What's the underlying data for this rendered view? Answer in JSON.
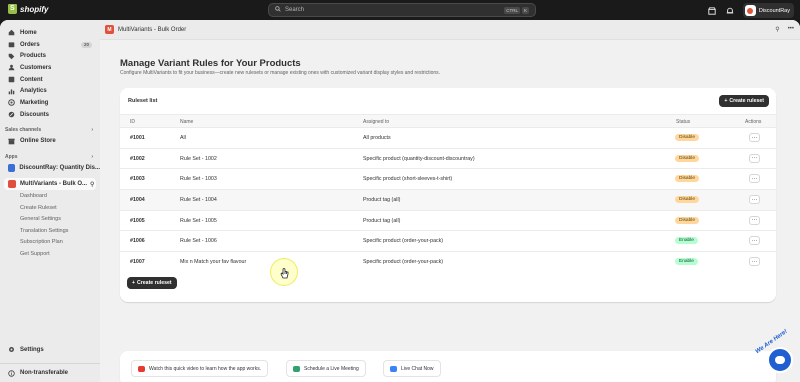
{
  "topbar": {
    "brand": "shopify",
    "search_placeholder": "Search",
    "shortcut_keys": [
      "CTRL",
      "K"
    ],
    "store_name": "DiscountRay"
  },
  "sidebar": {
    "items": [
      {
        "label": "Home",
        "icon": "home-icon"
      },
      {
        "label": "Orders",
        "icon": "orders-icon",
        "badge": "20"
      },
      {
        "label": "Products",
        "icon": "tag-icon"
      },
      {
        "label": "Customers",
        "icon": "person-icon"
      },
      {
        "label": "Content",
        "icon": "content-icon"
      },
      {
        "label": "Analytics",
        "icon": "bar-chart-icon"
      },
      {
        "label": "Marketing",
        "icon": "target-icon"
      },
      {
        "label": "Discounts",
        "icon": "discount-icon"
      }
    ],
    "sales_channels_label": "Sales channels",
    "online_store": "Online Store",
    "apps_label": "Apps",
    "app_discountray": "DiscountRay: Quantity Dis...",
    "app_multivariants": "MultiVariants - Bulk O...",
    "sub_items": [
      "Dashboard",
      "Create Ruleset",
      "General Settings",
      "Translation Settings",
      "Subscription Plan",
      "Get Support"
    ],
    "settings": "Settings",
    "non_transferable": "Non-transferable"
  },
  "apphead": {
    "title": "MultiVariants - Bulk Order"
  },
  "page": {
    "title": "Manage Variant Rules for Your Products",
    "subtitle": "Configure MultiVariants to fit your business—create new rulesets or manage existing ones with customized variant display styles and restrictions."
  },
  "ruleset": {
    "heading": "Ruleset list",
    "create_button": "Create ruleset",
    "columns": {
      "id": "ID",
      "name": "Name",
      "assigned": "Assigned to",
      "status": "Status",
      "actions": "Actions"
    },
    "rows": [
      {
        "id": "#1001",
        "name": "All",
        "assigned": "All products",
        "status": "Disable"
      },
      {
        "id": "#1002",
        "name": "Rule Set - 1002",
        "assigned": "Specific product (quantity-discount-discountray)",
        "status": "Disable"
      },
      {
        "id": "#1003",
        "name": "Rule Set - 1003",
        "assigned": "Specific product (short-sleeves-t-shirt)",
        "status": "Disable"
      },
      {
        "id": "#1004",
        "name": "Rule Set - 1004",
        "assigned": "Product tag (all)",
        "status": "Disable"
      },
      {
        "id": "#1005",
        "name": "Rule Set - 1005",
        "assigned": "Product tag (all)",
        "status": "Disable"
      },
      {
        "id": "#1006",
        "name": "Rule Set - 1006",
        "assigned": "Specific product (order-your-pack)",
        "status": "Enable"
      },
      {
        "id": "#1007",
        "name": "Mix n Match your fav flavour",
        "assigned": "Specific product (order-your-pack)",
        "status": "Enable"
      }
    ],
    "footer_create_button": "Create ruleset"
  },
  "help": {
    "video": "Watch this quick video to learn how the app works.",
    "meeting": "Schedule a Live Meeting",
    "chat": "Live Chat Now"
  },
  "chat_widget": {
    "text": "We Are Here!"
  },
  "colors": {
    "disable_bg": "#ffd79d",
    "enable_bg": "#b4fed2",
    "brand_green": "#95bf47",
    "app_red": "#e0503d"
  }
}
